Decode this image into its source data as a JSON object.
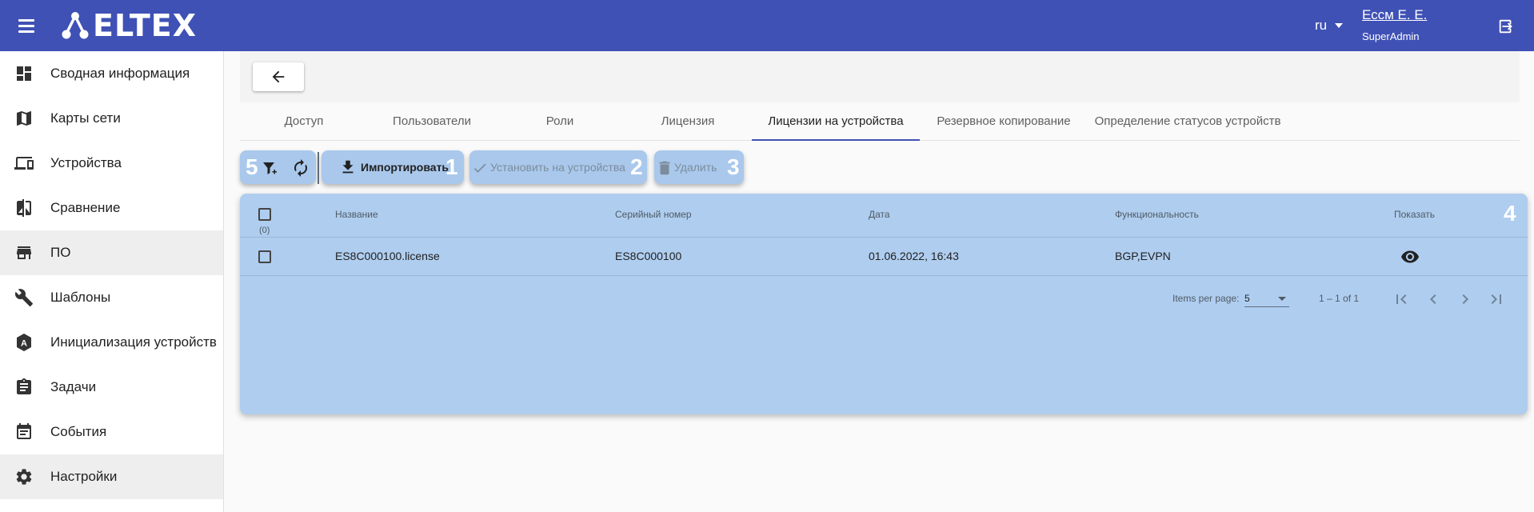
{
  "header": {
    "logo_text": "ELTEX",
    "lang": "ru",
    "user_name": "Ессм Е. Е.",
    "user_role": "SuperAdmin",
    "brand_color": "#3f51b5"
  },
  "sidebar": {
    "items": [
      {
        "label": "Сводная информация",
        "icon": "dashboard-icon"
      },
      {
        "label": "Карты сети",
        "icon": "map-icon"
      },
      {
        "label": "Устройства",
        "icon": "devices-icon"
      },
      {
        "label": "Сравнение",
        "icon": "compare-icon"
      },
      {
        "label": "ПО",
        "icon": "store-icon"
      },
      {
        "label": "Шаблоны",
        "icon": "wrench-icon"
      },
      {
        "label": "Инициализация устройств",
        "icon": "auto-icon"
      },
      {
        "label": "Задачи",
        "icon": "clipboard-icon"
      },
      {
        "label": "События",
        "icon": "calendar-icon"
      },
      {
        "label": "Настройки",
        "icon": "gear-icon"
      }
    ]
  },
  "tabs": [
    {
      "label": "Доступ"
    },
    {
      "label": "Пользователи"
    },
    {
      "label": "Роли"
    },
    {
      "label": "Лицензия"
    },
    {
      "label": "Лицензии на устройства",
      "active": true
    },
    {
      "label": "Резервное копирование"
    },
    {
      "label": "Определение статусов устройств"
    }
  ],
  "toolbar": {
    "filter_badge": "5",
    "import_label": "Импортировать",
    "import_badge": "1",
    "install_label": "Установить на устройства",
    "install_badge": "2",
    "delete_label": "Удалить",
    "delete_badge": "3"
  },
  "table": {
    "badge": "4",
    "selected_count": "(0)",
    "headers": {
      "name": "Название",
      "serial": "Серийный номер",
      "date": "Дата",
      "features": "Функциональность",
      "show": "Показать"
    },
    "rows": [
      {
        "name": "ES8C000100.license",
        "serial": "ES8C000100",
        "date": "01.06.2022, 16:43",
        "features": "BGP,EVPN"
      }
    ]
  },
  "pager": {
    "items_per_page_label": "Items per page:",
    "items_per_page": "5",
    "range": "1 – 1 of 1"
  }
}
